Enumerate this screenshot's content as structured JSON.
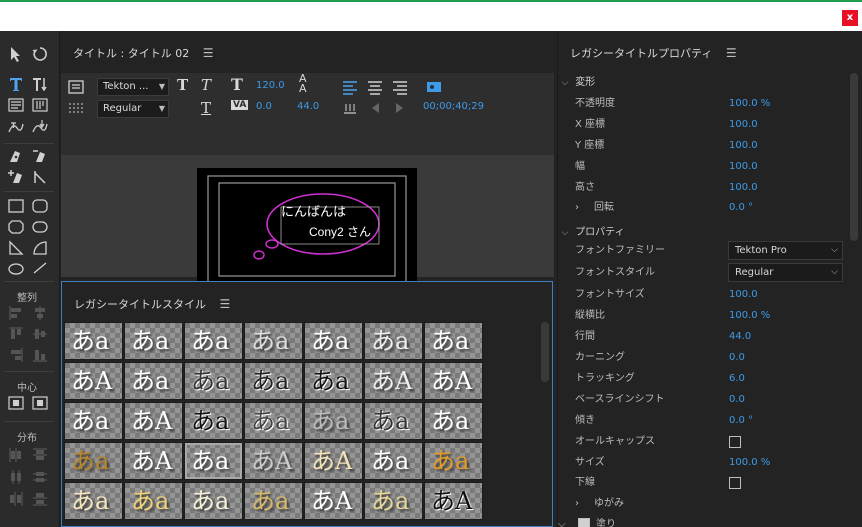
{
  "window": {
    "close_label": "x"
  },
  "tools": {
    "align_label": "整列",
    "center_label": "中心",
    "distribute_label": "分布"
  },
  "title_panel": {
    "title": "タイトル : タイトル 02",
    "font_family": "Tekton ...",
    "font_style": "Regular",
    "font_size": "120.0",
    "tracking": "0.0",
    "leading": "44.0",
    "timecode": "00;00;40;29",
    "canvas_text_line1": "にんばんは",
    "canvas_text_line2": "Cony2 さん"
  },
  "styles_panel": {
    "title": "レガシータイトルスタイル",
    "swatch_text_a": "あa",
    "swatch_text_b": "あA"
  },
  "props": {
    "title": "レガシータイトルプロパティ",
    "transform": {
      "section": "変形",
      "rows": [
        {
          "label": "不透明度",
          "value": "100.0 %"
        },
        {
          "label": "X 座標",
          "value": "100.0"
        },
        {
          "label": "Y 座標",
          "value": "100.0"
        },
        {
          "label": "幅",
          "value": "100.0"
        },
        {
          "label": "高さ",
          "value": "100.0"
        }
      ],
      "rotation_label": "回転",
      "rotation_value": "0.0 °"
    },
    "properties": {
      "section": "プロパティ",
      "font_family_label": "フォントファミリー",
      "font_family_value": "Tekton Pro",
      "font_style_label": "フォントスタイル",
      "font_style_value": "Regular",
      "rows": [
        {
          "label": "フォントサイズ",
          "value": "100.0"
        },
        {
          "label": "縦横比",
          "value": "100.0 %"
        },
        {
          "label": "行間",
          "value": "44.0"
        },
        {
          "label": "カーニング",
          "value": "0.0"
        },
        {
          "label": "トラッキング",
          "value": "6.0"
        },
        {
          "label": "ベースラインシフト",
          "value": "0.0"
        },
        {
          "label": "傾き",
          "value": "0.0 °"
        }
      ],
      "all_caps_label": "オールキャップス",
      "size_label": "サイズ",
      "size_value": "100.0 %",
      "underline_label": "下線",
      "distort_label": "ゆがみ",
      "fill_label": "塗り"
    }
  },
  "colors": {
    "accent_blue": "#3d9be9",
    "ellipse_magenta": "#d030d0",
    "panel_focus": "#3d7fc0"
  }
}
